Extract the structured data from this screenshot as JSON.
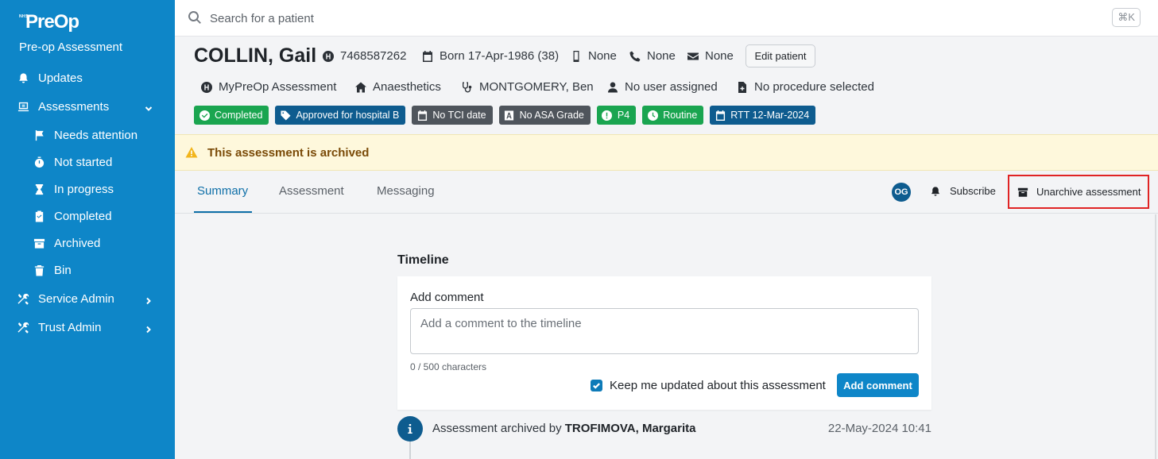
{
  "app": {
    "logo_sup": "NHS",
    "logo": "PreOp",
    "subtitle": "Pre-op Assessment"
  },
  "sidebar": {
    "items": [
      {
        "label": "Updates",
        "icon": "bell-icon"
      },
      {
        "label": "Assessments",
        "icon": "clipboard-icon",
        "expanded": true
      },
      {
        "label": "Needs attention",
        "icon": "flag-icon"
      },
      {
        "label": "Not started",
        "icon": "stopwatch-icon"
      },
      {
        "label": "In progress",
        "icon": "hourglass-icon"
      },
      {
        "label": "Completed",
        "icon": "clipboard-check-icon"
      },
      {
        "label": "Archived",
        "icon": "archive-box-icon"
      },
      {
        "label": "Bin",
        "icon": "trash-icon"
      },
      {
        "label": "Service Admin",
        "icon": "tools-icon"
      },
      {
        "label": "Trust Admin",
        "icon": "tools-icon"
      }
    ]
  },
  "search": {
    "placeholder": "Search for a patient",
    "shortcut": "⌘K"
  },
  "patient": {
    "name": "COLLIN, Gail",
    "nhs_number": "7468587262",
    "born": "Born 17-Apr-1986 (38)",
    "mobile": "None",
    "phone": "None",
    "email": "None",
    "edit_label": "Edit patient",
    "assessment_type": "MyPreOp Assessment",
    "department": "Anaesthetics",
    "clinician": "MONTGOMERY, Ben",
    "assigned_user": "No user assigned",
    "procedure": "No procedure selected"
  },
  "badges": [
    {
      "label": "Completed",
      "color": "#1aa550"
    },
    {
      "label": "Approved for hospital B",
      "color": "#0e5c8f"
    },
    {
      "label": "No TCI date",
      "color": "#4f555c"
    },
    {
      "label": "No ASA Grade",
      "color": "#4f555c"
    },
    {
      "label": "P4",
      "color": "#1aa550"
    },
    {
      "label": "Routine",
      "color": "#1aa550"
    },
    {
      "label": "RTT 12-Mar-2024",
      "color": "#0e5c8f"
    }
  ],
  "banner": {
    "text": "This assessment is archived"
  },
  "tabs": [
    {
      "label": "Summary",
      "active": true
    },
    {
      "label": "Assessment",
      "active": false
    },
    {
      "label": "Messaging",
      "active": false
    }
  ],
  "actions": {
    "avatar_initials": "OG",
    "subscribe_label": "Subscribe",
    "unarchive_label": "Unarchive assessment"
  },
  "timeline": {
    "heading": "Timeline",
    "add_comment_label": "Add comment",
    "comment_placeholder": "Add a comment to the timeline",
    "char_count": "0 / 500 characters",
    "keep_updated_label": "Keep me updated about this assessment",
    "keep_updated_checked": true,
    "add_button_label": "Add comment",
    "entries": [
      {
        "text": "Assessment archived by ",
        "user": "TROFIMOVA, Margarita",
        "time": "22-May-2024 10:41"
      }
    ]
  },
  "colors": {
    "sidebar_bg": "#0e86c8",
    "accent": "#0e6fa8",
    "banner_bg": "#fef8dc",
    "highlight_border": "#e02424"
  }
}
